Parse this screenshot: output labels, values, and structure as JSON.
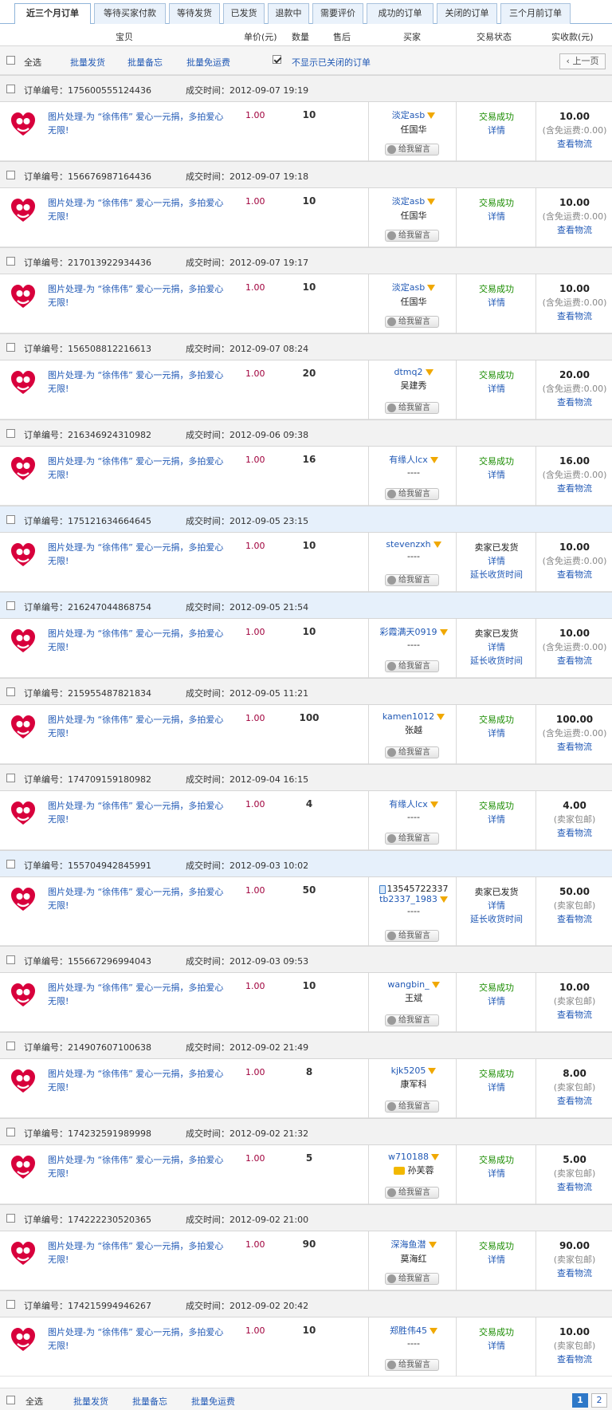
{
  "tabs": [
    {
      "label": "近三个月订单",
      "active": true
    },
    {
      "label": "等待买家付款",
      "active": false
    },
    {
      "label": "等待发货",
      "active": false
    },
    {
      "label": "已发货",
      "active": false
    },
    {
      "label": "退款中",
      "active": false
    },
    {
      "label": "需要评价",
      "active": false
    },
    {
      "label": "成功的订单",
      "active": false
    },
    {
      "label": "关闭的订单",
      "active": false
    },
    {
      "label": "三个月前订单",
      "active": false
    }
  ],
  "columns": {
    "item": "宝贝",
    "price": "单价(元)",
    "qty": "数量",
    "aftersale": "售后",
    "buyer": "买家",
    "status": "交易状态",
    "amount": "实收款(元)"
  },
  "toolbar": {
    "select_all": "全选",
    "batch_ship": "批量发货",
    "batch_memo": "批量备忘",
    "batch_free_ship": "批量免运费",
    "hide_closed_label": "不显示已关闭的订单",
    "hide_closed_checked": true,
    "prev_page": "上一页"
  },
  "labels": {
    "order_no_prefix": "订单编号：",
    "time_prefix": "成交时间：",
    "leave_msg": "给我留言",
    "details": "详情",
    "view_logistics": "查看物流",
    "extend_receipt": "延长收货时间"
  },
  "item_title": "图片处理-为 “徐伟伟” 爱心一元捐，多拍爱心无限!",
  "orders": [
    {
      "order_no": "175600555124436",
      "time": "2012-09-07 19:19",
      "price": "1.00",
      "qty": "10",
      "buyer": "淡定asb",
      "real_name": "任国华",
      "status": "交易成功",
      "status_type": "ok",
      "amount": "10.00",
      "ship_note": "(含免运费:0.00)",
      "head_style": "grey"
    },
    {
      "order_no": "156676987164436",
      "time": "2012-09-07 19:18",
      "price": "1.00",
      "qty": "10",
      "buyer": "淡定asb",
      "real_name": "任国华",
      "status": "交易成功",
      "status_type": "ok",
      "amount": "10.00",
      "ship_note": "(含免运费:0.00)",
      "head_style": "grey"
    },
    {
      "order_no": "217013922934436",
      "time": "2012-09-07 19:17",
      "price": "1.00",
      "qty": "10",
      "buyer": "淡定asb",
      "real_name": "任国华",
      "status": "交易成功",
      "status_type": "ok",
      "amount": "10.00",
      "ship_note": "(含免运费:0.00)",
      "head_style": "grey"
    },
    {
      "order_no": "156508812216613",
      "time": "2012-09-07 08:24",
      "price": "1.00",
      "qty": "20",
      "buyer": "dtmq2",
      "real_name": "吴建秀",
      "status": "交易成功",
      "status_type": "ok",
      "amount": "20.00",
      "ship_note": "(含免运费:0.00)",
      "head_style": "grey"
    },
    {
      "order_no": "216346924310982",
      "time": "2012-09-06 09:38",
      "price": "1.00",
      "qty": "16",
      "buyer": "有缘人lcx",
      "real_name": "----",
      "status": "交易成功",
      "status_type": "ok",
      "amount": "16.00",
      "ship_note": "(含免运费:0.00)",
      "head_style": "grey"
    },
    {
      "order_no": "175121634664645",
      "time": "2012-09-05 23:15",
      "price": "1.00",
      "qty": "10",
      "buyer": "stevenzxh",
      "real_name": "----",
      "status": "卖家已发货",
      "status_type": "ship",
      "amount": "10.00",
      "ship_note": "(含免运费:0.00)",
      "head_style": "blue"
    },
    {
      "order_no": "216247044868754",
      "time": "2012-09-05 21:54",
      "price": "1.00",
      "qty": "10",
      "buyer": "彩霞满天0919",
      "real_name": "----",
      "status": "卖家已发货",
      "status_type": "ship",
      "amount": "10.00",
      "ship_note": "(含免运费:0.00)",
      "head_style": "blue"
    },
    {
      "order_no": "215955487821834",
      "time": "2012-09-05 11:21",
      "price": "1.00",
      "qty": "100",
      "buyer": "kamen1012",
      "real_name": "张越",
      "status": "交易成功",
      "status_type": "ok",
      "amount": "100.00",
      "ship_note": "(含免运费:0.00)",
      "head_style": "grey"
    },
    {
      "order_no": "174709159180982",
      "time": "2012-09-04 16:15",
      "price": "1.00",
      "qty": "4",
      "buyer": "有缘人lcx",
      "real_name": "----",
      "status": "交易成功",
      "status_type": "ok",
      "amount": "4.00",
      "ship_note": "(卖家包邮)",
      "head_style": "grey"
    },
    {
      "order_no": "155704942845991",
      "time": "2012-09-03 10:02",
      "price": "1.00",
      "qty": "50",
      "phone": "13545722337",
      "buyer": "tb2337_1983",
      "real_name": "----",
      "status": "卖家已发货",
      "status_type": "ship",
      "amount": "50.00",
      "ship_note": "(卖家包邮)",
      "head_style": "blue"
    },
    {
      "order_no": "155667296994043",
      "time": "2012-09-03 09:53",
      "price": "1.00",
      "qty": "10",
      "buyer": "wangbin_",
      "real_name": "王斌",
      "status": "交易成功",
      "status_type": "ok",
      "amount": "10.00",
      "ship_note": "(卖家包邮)",
      "head_style": "grey"
    },
    {
      "order_no": "214907607100638",
      "time": "2012-09-02 21:49",
      "price": "1.00",
      "qty": "8",
      "buyer": "kjk5205",
      "real_name": "康军科",
      "status": "交易成功",
      "status_type": "ok",
      "amount": "8.00",
      "ship_note": "(卖家包邮)",
      "head_style": "grey"
    },
    {
      "order_no": "174232591989998",
      "time": "2012-09-02 21:32",
      "price": "1.00",
      "qty": "5",
      "buyer": "w710188",
      "real_name": "孙芙蓉",
      "chat": true,
      "status": "交易成功",
      "status_type": "ok",
      "amount": "5.00",
      "ship_note": "(卖家包邮)",
      "head_style": "grey"
    },
    {
      "order_no": "174222230520365",
      "time": "2012-09-02 21:00",
      "price": "1.00",
      "qty": "90",
      "buyer": "深海鱼潜",
      "real_name": "莫海红",
      "status": "交易成功",
      "status_type": "ok",
      "amount": "90.00",
      "ship_note": "(卖家包邮)",
      "head_style": "grey"
    },
    {
      "order_no": "174215994946267",
      "time": "2012-09-02 20:42",
      "price": "1.00",
      "qty": "10",
      "buyer": "郑胜伟45",
      "real_name": "----",
      "status": "交易成功",
      "status_type": "ok",
      "amount": "10.00",
      "ship_note": "(卖家包邮)",
      "head_style": "grey"
    }
  ],
  "footer": {
    "select_all": "全选",
    "batch_ship": "批量发货",
    "batch_memo": "批量备忘",
    "batch_free_ship": "批量免运费",
    "pages": [
      "1",
      "2"
    ],
    "current_page": "1"
  },
  "colors": {
    "link": "#2159b5",
    "price": "#a0003c",
    "success": "#1a8c00",
    "heart": "#d8003c",
    "page_current": "#2e78c8"
  }
}
